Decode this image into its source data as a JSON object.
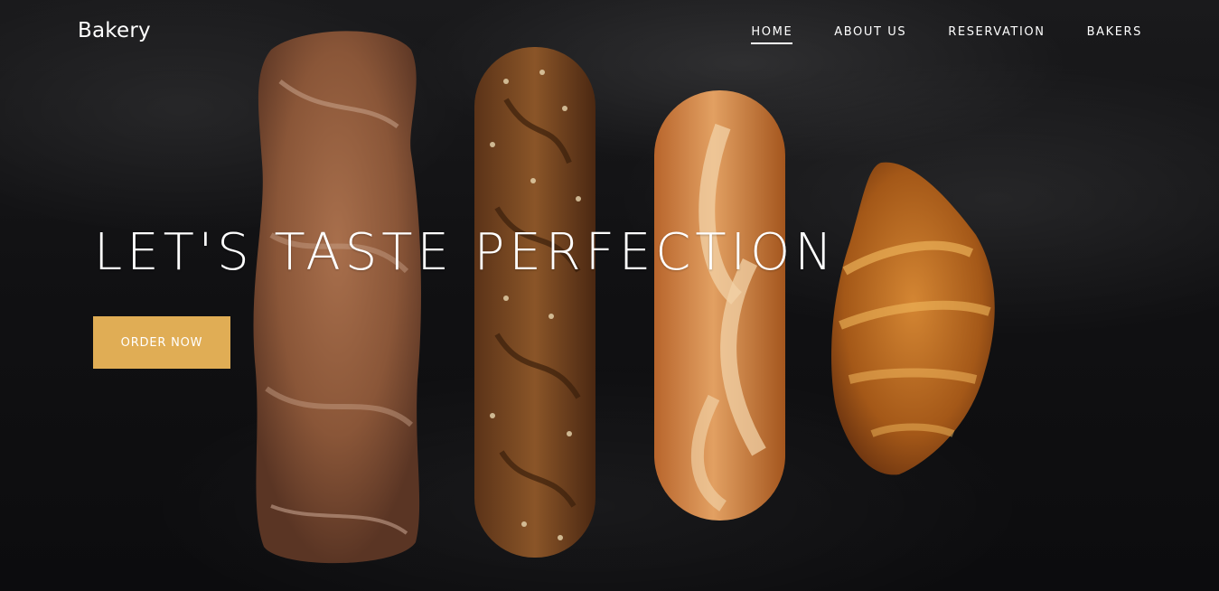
{
  "brand": {
    "name": "Bakery"
  },
  "nav": {
    "items": [
      {
        "label": "HOME",
        "active": true
      },
      {
        "label": "ABOUT US",
        "active": false
      },
      {
        "label": "RESERVATION",
        "active": false
      },
      {
        "label": "BAKERS",
        "active": false
      }
    ]
  },
  "hero": {
    "headline": "LET'S TASTE PERFECTION",
    "cta_label": "ORDER NOW",
    "background_image": "dark-flour-dusted-surface-with-breads",
    "accent_color": "#e0ad55"
  }
}
